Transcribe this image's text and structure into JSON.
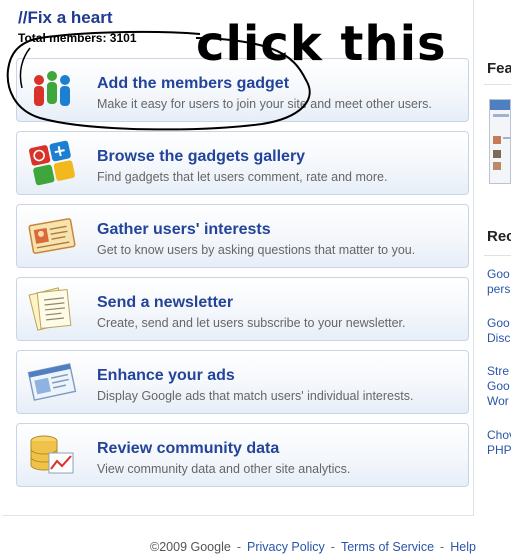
{
  "header": {
    "site_title": "//Fix a heart",
    "members_count": "Total members: 3101"
  },
  "annotation": {
    "text": "click this"
  },
  "cards": [
    {
      "title": "Add the members gadget",
      "description": "Make it easy for users to join your site and meet other users.",
      "icon": "members-gadget-icon"
    },
    {
      "title": "Browse the gadgets gallery",
      "description": "Find gadgets that let users comment, rate and more.",
      "icon": "gadgets-gallery-icon"
    },
    {
      "title": "Gather users' interests",
      "description": "Get to know users by asking questions that matter to you.",
      "icon": "interests-card-icon"
    },
    {
      "title": "Send a newsletter",
      "description": "Create, send and let users subscribe to your newsletter.",
      "icon": "newsletter-icon"
    },
    {
      "title": "Enhance your ads",
      "description": "Display Google ads that match users' individual interests.",
      "icon": "ads-icon"
    },
    {
      "title": "Review community data",
      "description": "View community data and other site analytics.",
      "icon": "community-data-icon"
    }
  ],
  "sidebar": {
    "featured_heading": "Fea",
    "recent_heading": "Rec",
    "links": [
      [
        "Goo",
        "pers"
      ],
      [
        "Goo",
        "Disc"
      ],
      [
        "Stre",
        "Goo",
        "Wor"
      ],
      [
        "Chov",
        "PHP"
      ]
    ]
  },
  "footer": {
    "copyright": "©2009 Google",
    "privacy": "Privacy Policy",
    "terms": "Terms of Service",
    "help": "Help"
  },
  "colors": {
    "title_blue": "#23449a",
    "link_blue": "#2a55a8"
  }
}
